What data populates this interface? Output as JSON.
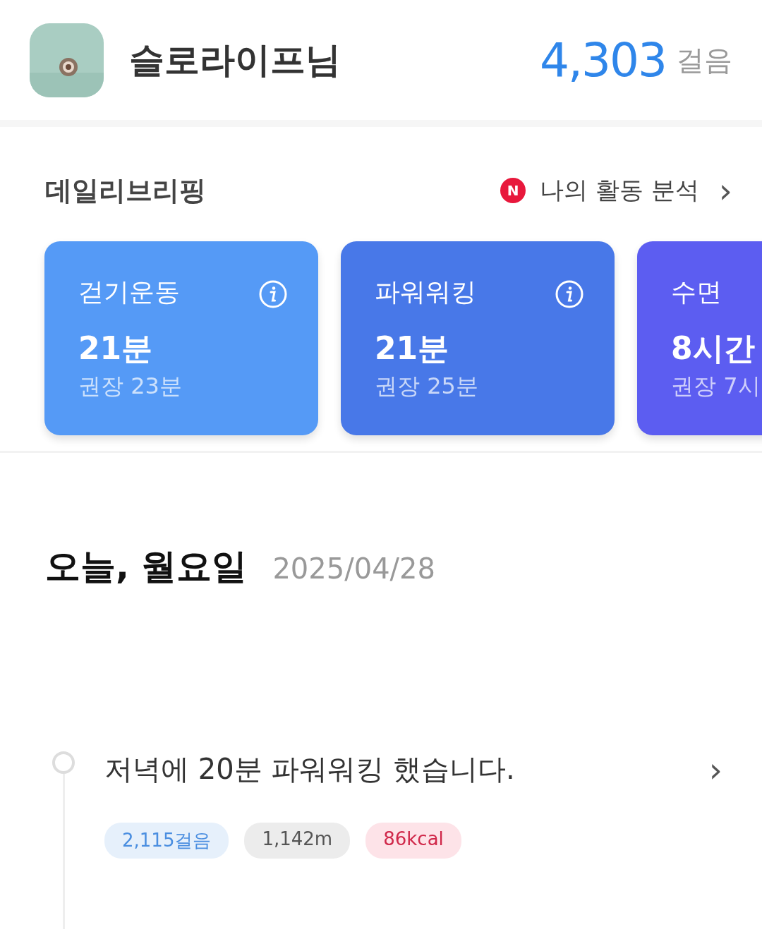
{
  "header": {
    "name": "슬로라이프님",
    "steps": "4,303",
    "steps_unit": "걸음"
  },
  "briefing": {
    "title": "데일리브리핑",
    "badge": "N",
    "link": "나의 활동 분석",
    "arrow": "›"
  },
  "cards": [
    {
      "title": "걷기운동",
      "value": "21분",
      "recommend": "권장 23분",
      "info": true,
      "color": "#559af6"
    },
    {
      "title": "파워워킹",
      "value": "21분",
      "recommend": "권장 25분",
      "info": true,
      "color": "#4878e8"
    },
    {
      "title": "수면",
      "value": "8시간",
      "recommend": "권장 7시",
      "info": false,
      "color": "#5c5df1"
    }
  ],
  "today": {
    "title": "오늘, 월요일",
    "date": "2025/04/28"
  },
  "timeline": [
    {
      "text": "저녁에 20분 파워워킹 했습니다.",
      "arrow": "›",
      "chips": [
        {
          "kind": "steps",
          "label": "2,115걸음"
        },
        {
          "kind": "distance",
          "label": "1,142m"
        },
        {
          "kind": "calories",
          "label": "86kcal"
        }
      ]
    }
  ]
}
